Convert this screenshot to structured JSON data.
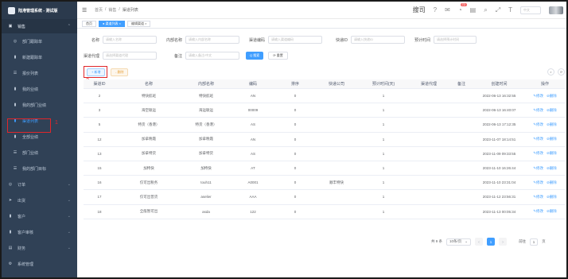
{
  "app": {
    "title": "陆港管理系统 - 测试版"
  },
  "sidebar": {
    "group_label": "销售",
    "items": [
      {
        "label": "部门跟踪单",
        "icon": "location-icon"
      },
      {
        "label": "新建跟踪单",
        "icon": "bar-chart-icon"
      },
      {
        "label": "报价列表",
        "icon": "list-icon"
      },
      {
        "label": "我的业绩",
        "icon": "bar-chart-icon"
      },
      {
        "label": "我的部门业绩",
        "icon": "bar-chart-icon"
      },
      {
        "label": "渠道列表",
        "icon": "bar-chart-icon",
        "active": true
      },
      {
        "label": "全部业绩",
        "icon": "bar-chart-icon"
      },
      {
        "label": "部门业绩",
        "icon": "list-icon"
      },
      {
        "label": "我的部门目标",
        "icon": "list-icon"
      }
    ],
    "top_items": [
      {
        "label": "订单"
      },
      {
        "label": "出货"
      },
      {
        "label": "客户"
      },
      {
        "label": "客户审核"
      },
      {
        "label": "财务"
      },
      {
        "label": "系统管理"
      }
    ]
  },
  "annotations": {
    "num1": "1",
    "num2": "2"
  },
  "header": {
    "breadcrumb": [
      "首页",
      "/",
      "销售",
      "/",
      "渠道列表"
    ],
    "right_label": "搜司",
    "notif_count": "72",
    "lang": "中文",
    "search_placeholder": "中文"
  },
  "tags": [
    {
      "label": "首页",
      "active": false
    },
    {
      "label": "● 渠道列表 ×",
      "active": true
    },
    {
      "label": "编辑渠道 ×",
      "active": false
    }
  ],
  "filters": {
    "row1": [
      {
        "label": "名称",
        "placeholder": "请输入名称"
      },
      {
        "label": "内部名称",
        "placeholder": "请输入内部名称"
      },
      {
        "label": "渠道编码",
        "placeholder": "请输入渠道编码"
      },
      {
        "label": "快递ID",
        "placeholder": "请输入快递ID"
      },
      {
        "label": "预计时间",
        "placeholder": "请选择预计时间"
      }
    ],
    "row2": [
      {
        "label": "渠道代理",
        "placeholder": "请选择渠道代理"
      },
      {
        "label": "备注",
        "placeholder": "请输入备注/中文"
      }
    ],
    "search_label": "Q 搜索",
    "reset_label": "⟳ 重置"
  },
  "toolbar": {
    "add_label": "+ 新增",
    "delete_label": "- 删除"
  },
  "table": {
    "headers": [
      "渠道ID",
      "名称",
      "内部名称",
      "编码",
      "排序",
      "快递公司",
      "预计时间(天)",
      "渠道代理",
      "备注",
      "创建时间",
      "操作"
    ],
    "rows": [
      [
        "2",
        "特快航班",
        "特快航班",
        "AN",
        "0",
        "",
        "1",
        "",
        "",
        "2022-06-13 16:32:55"
      ],
      [
        "3",
        "海空联运",
        "海运联运",
        "00009",
        "0",
        "",
        "1",
        "",
        "",
        "2022-06-13 16:40:07"
      ],
      [
        "5",
        "特货（香港）",
        "特货（香港）",
        "AS",
        "0",
        "",
        "1",
        "",
        "",
        "2022-06-13 17:12:35"
      ],
      [
        "12",
        "加拿晚霞",
        "加拿晚霞",
        "AN",
        "0",
        "",
        "1",
        "",
        "",
        "2023-11-07 18:14:51"
      ],
      [
        "13",
        "加拿特货",
        "加拿特货",
        "AS",
        "0",
        "",
        "1",
        "",
        "",
        "2023-11-09 09:33:55"
      ],
      [
        "15",
        "加特快",
        "加特快",
        "AT",
        "0",
        "",
        "1",
        "",
        "",
        "2023-11-10 16:26:44"
      ],
      [
        "16",
        "仅可出税务",
        "touh11",
        "A0001",
        "0",
        "顺丰特快",
        "1",
        "",
        "",
        "2023-11-10 23:31:04"
      ],
      [
        "17",
        "仅可出普货",
        "aselier",
        "AAA",
        "0",
        "",
        "1",
        "",
        "",
        "2023-11-12 23:56:31"
      ],
      [
        "18",
        "全般暂可出",
        "asda",
        "122",
        "0",
        "",
        "1",
        "",
        "",
        "2023-11-13 00:05:34"
      ]
    ],
    "edit_label": "✎修改",
    "delete_label": "⊘删除"
  },
  "pagination": {
    "total": "共 9 条",
    "page_size": "10条/页",
    "prev": "<",
    "current": "1",
    "next": ">",
    "goto_label": "前往",
    "goto_value": "1",
    "page_suffix": "页"
  }
}
